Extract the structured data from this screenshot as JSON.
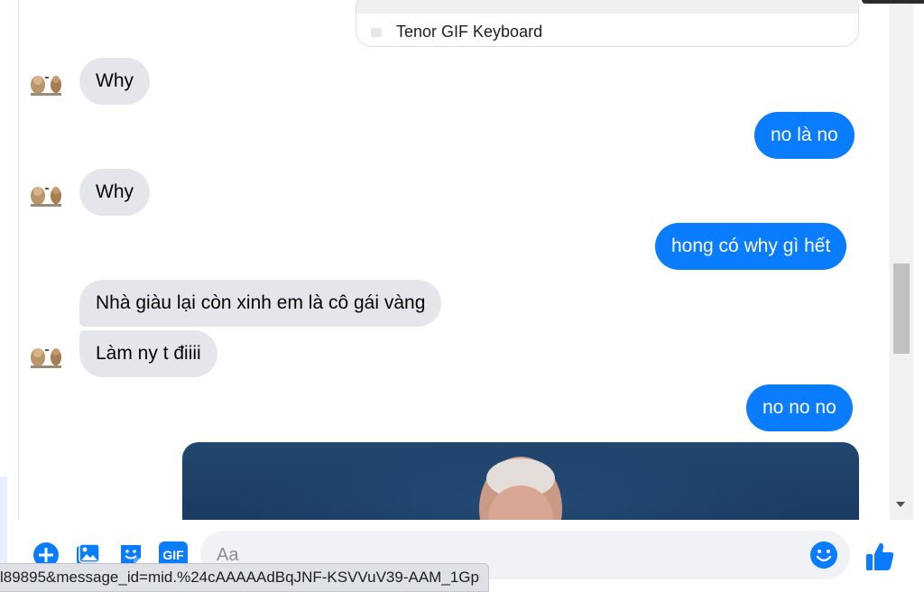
{
  "link_preview": {
    "source": "Tenor GIF Keyboard"
  },
  "messages": [
    {
      "side": "in",
      "text": "Why"
    },
    {
      "side": "out",
      "text": "no là no"
    },
    {
      "side": "in",
      "text": "Why"
    },
    {
      "side": "out",
      "text": "hong có why gì hết"
    },
    {
      "side": "in",
      "text": "Nhà giàu lại còn xinh em là cô gái vàng"
    },
    {
      "side": "in",
      "text": "Làm ny t điiii"
    },
    {
      "side": "out",
      "text": "no no no"
    }
  ],
  "composer": {
    "placeholder": "Aa",
    "icons": [
      "plus-circle-icon",
      "photo-icon",
      "sticker-icon",
      "gif-icon",
      "emoji-icon",
      "thumbs-up-icon"
    ],
    "gif_label": "GIF"
  },
  "status_bar": {
    "url": "l89895&message_id=mid.%24cAAAAAdBqJNF-KSVVuV39-AAM_1Gp"
  },
  "colors": {
    "outgoing": "#0a7cff",
    "incoming": "#e4e6eb",
    "accent": "#0a7cff"
  }
}
